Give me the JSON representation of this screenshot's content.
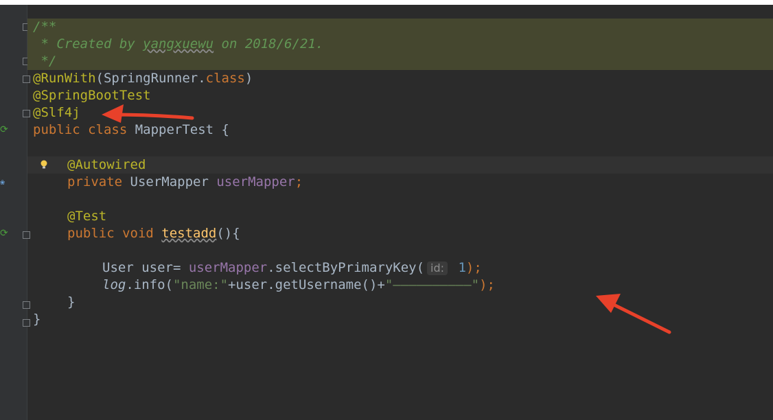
{
  "editor": {
    "lines": {
      "l1": {
        "comment": "/**"
      },
      "l2": {
        "comment_a": " * Created by ",
        "author": "yangxuewu",
        "comment_b": " on 2018/6/21."
      },
      "l3": {
        "comment": " */"
      },
      "l4": {
        "ann": "@RunWith",
        "paren_open": "(SpringRunner.",
        "kw": "class",
        "paren_close": ")"
      },
      "l5": {
        "ann": "@SpringBootTest"
      },
      "l6": {
        "ann": "@Slf4j"
      },
      "l7": {
        "kw1": "public ",
        "kw2": "class ",
        "name": "MapperTest {"
      },
      "l9": {
        "ann": "@Autowired"
      },
      "l10": {
        "kw": "private ",
        "type": "UserMapper ",
        "field": "userMapper",
        "semi": ";"
      },
      "l12": {
        "ann": "@Test"
      },
      "l13": {
        "kw": "public void ",
        "method": "testadd",
        "rest": "(){"
      },
      "l15": {
        "a": "User user= ",
        "field": "userMapper",
        "b": ".selectByPrimaryKey(",
        "hint": "id:",
        "num": " 1",
        "c": ");"
      },
      "l16": {
        "log": "log",
        "a": ".info(",
        "str1": "\"name:\"",
        "b": "+user.getUsername()+",
        "str2": "\"——————————\"",
        "c": ");"
      },
      "l17": {
        "brace": "}"
      },
      "l18": {
        "brace": "}"
      }
    }
  },
  "colors": {
    "background": "#2b2b2b",
    "annotation": "#bbb529",
    "keyword": "#cc7832",
    "string": "#6a8759",
    "comment": "#629755",
    "field": "#9876aa",
    "arrow": "#e8412a"
  },
  "icons": [
    "fold-icon",
    "run-test-icon",
    "spring-bean-icon",
    "lightbulb-icon",
    "arrow-annotation"
  ]
}
